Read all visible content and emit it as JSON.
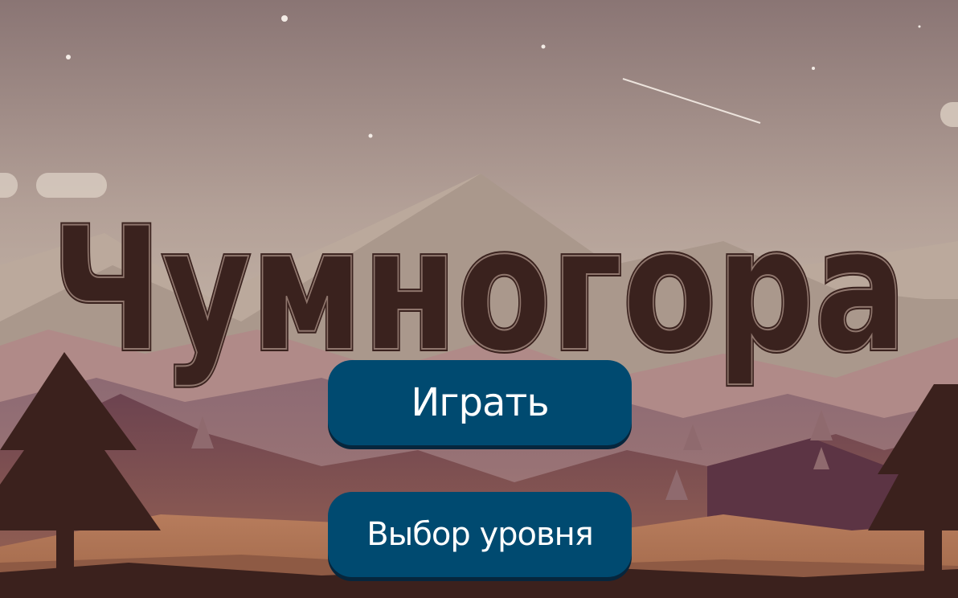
{
  "title": {
    "text": "Чумногора",
    "fill": "#3a221e"
  },
  "menu": {
    "play_label": "Играть",
    "level_select_label": "Выбор уровня",
    "button_color": "#004a70"
  },
  "background": {
    "sky_top": "#8a7676",
    "sky_bottom": "#cdbfb1",
    "tree_color": "#3b211d"
  }
}
